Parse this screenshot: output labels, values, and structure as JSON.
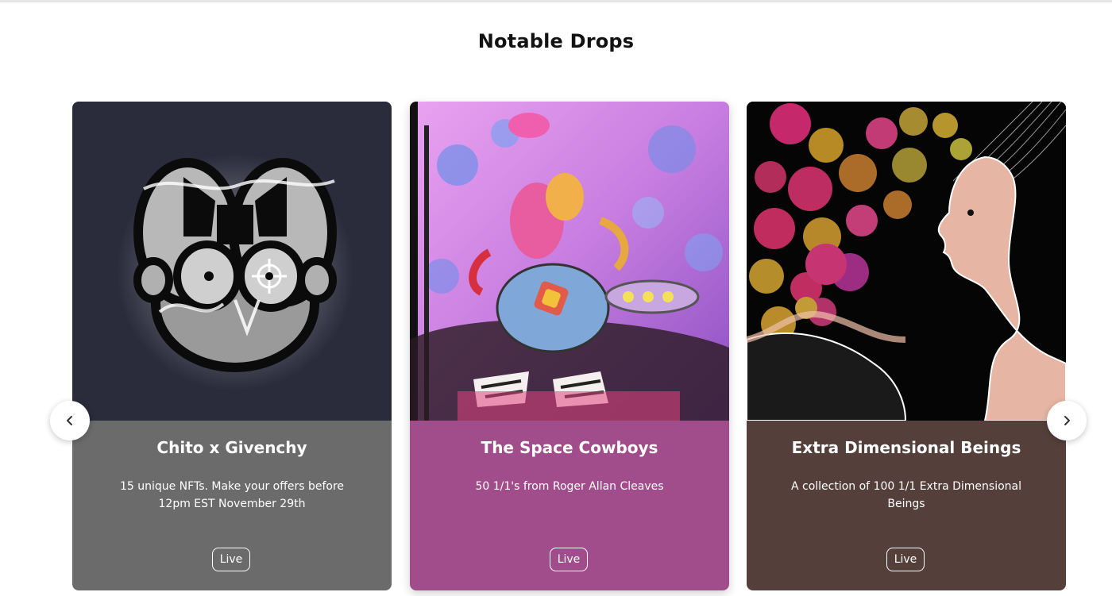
{
  "section": {
    "title": "Notable Drops"
  },
  "carousel": {
    "prev_icon": "chevron-left-icon",
    "next_icon": "chevron-right-icon",
    "cards": [
      {
        "name": "Chito x Givenchy",
        "description": "15 unique NFTs. Make your offers before 12pm EST November 29th",
        "status": "Live",
        "panel_color": "#6b6b6b",
        "art_background": "#2a2b3b"
      },
      {
        "name": "The Space Cowboys",
        "description": "50 1/1's from Roger Allan Cleaves",
        "status": "Live",
        "panel_color": "#a24d8b",
        "art_background": "#d98ee0"
      },
      {
        "name": "Extra Dimensional Beings",
        "description": "A collection of 100 1/1 Extra Dimensional Beings",
        "status": "Live",
        "panel_color": "#553f3a",
        "art_background": "#050505"
      }
    ]
  }
}
